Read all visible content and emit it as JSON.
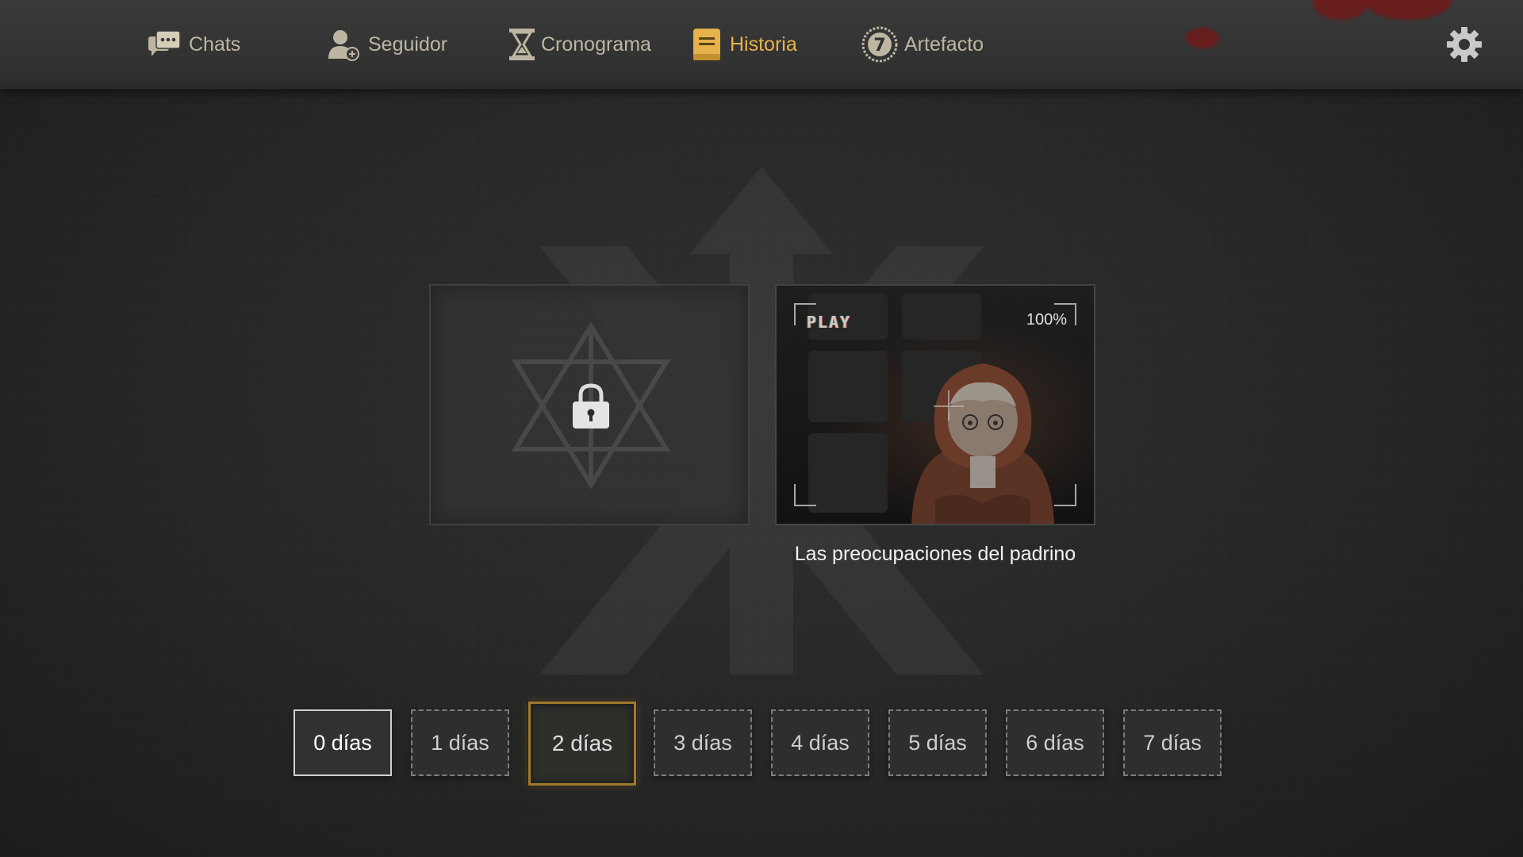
{
  "nav": {
    "items": [
      {
        "label": "Chats",
        "icon": "chat-bubbles-icon",
        "active": false
      },
      {
        "label": "Seguidor",
        "icon": "add-follower-icon",
        "active": false
      },
      {
        "label": "Cronograma",
        "icon": "hourglass-icon",
        "active": false
      },
      {
        "label": "Historia",
        "icon": "book-icon",
        "active": true
      },
      {
        "label": "Artefacto",
        "icon": "artifact-seven-icon",
        "active": false
      }
    ],
    "settings_icon": "gear-icon"
  },
  "cards": {
    "locked": {
      "icon": "lock-icon"
    },
    "story": {
      "play_label": "PLAY",
      "progress_label": "100%",
      "title": "Las preocupaciones del padrino"
    }
  },
  "days": {
    "items": [
      "0 días",
      "1 días",
      "2 días",
      "3 días",
      "4 días",
      "5 días",
      "6 días",
      "7 días"
    ],
    "current_index": 0,
    "selected_index": 2
  },
  "colors": {
    "accent": "#e6b24b",
    "nav_text": "#bdb6a2",
    "selected_border": "#a27a2d"
  }
}
